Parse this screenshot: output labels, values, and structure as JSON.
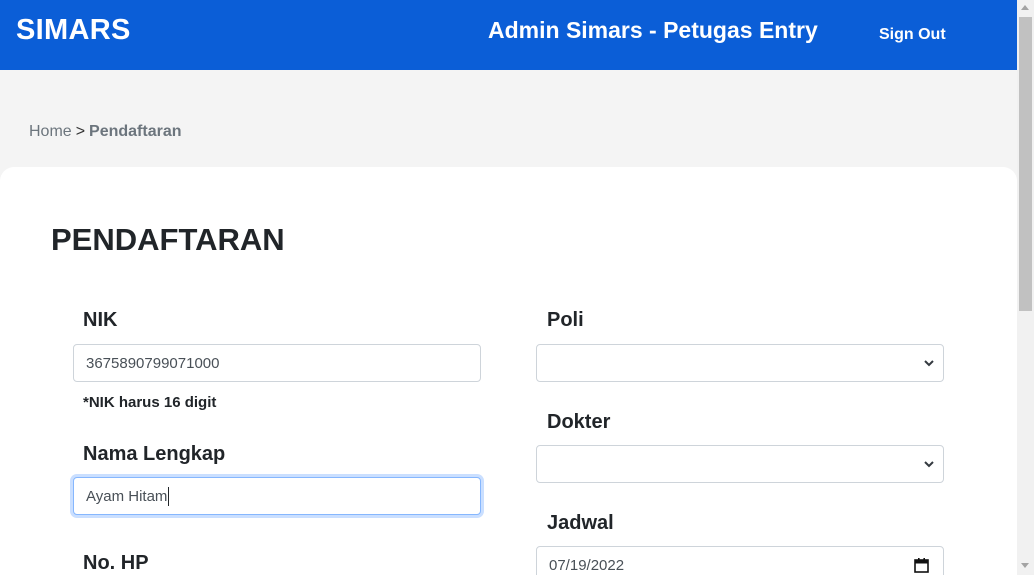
{
  "colors": {
    "navbar_bg": "#0b5ed7",
    "page_bg": "#f4f4f4",
    "card_bg": "#ffffff",
    "focus_border": "#86b7fe"
  },
  "navbar": {
    "brand": "SIMARS",
    "title": "Admin Simars - Petugas Entry",
    "signout": "Sign Out"
  },
  "breadcrumb": {
    "home": "Home",
    "separator": ">",
    "current": "Pendaftaran"
  },
  "form": {
    "title": "PENDAFTARAN",
    "nik": {
      "label": "NIK",
      "value": "3675890799071000",
      "hint": "*NIK harus 16 digit"
    },
    "nama": {
      "label": "Nama Lengkap",
      "value": "Ayam Hitam"
    },
    "hp": {
      "label": "No. HP"
    },
    "poli": {
      "label": "Poli",
      "value": ""
    },
    "dokter": {
      "label": "Dokter",
      "value": ""
    },
    "jadwal": {
      "label": "Jadwal",
      "value": "07/19/2022"
    }
  },
  "icons": {
    "select_arrow": "chevron-down-icon",
    "date_picker": "calendar-icon"
  }
}
